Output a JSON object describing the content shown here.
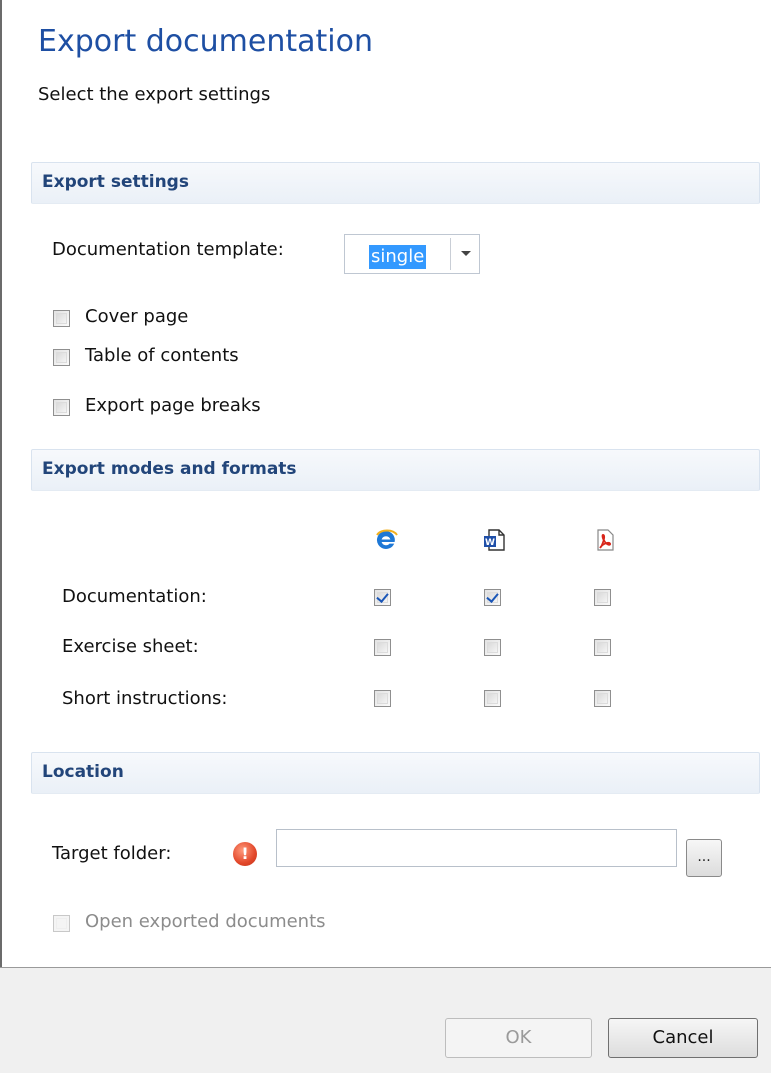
{
  "dialog": {
    "title": "Export documentation",
    "subtitle": "Select the export settings"
  },
  "export_settings": {
    "header": "Export settings",
    "template_label": "Documentation template:",
    "template_value": "single",
    "options": [
      {
        "label": "Cover page",
        "checked": false
      },
      {
        "label": "Table of contents",
        "checked": false
      },
      {
        "label": "Export page breaks",
        "checked": false
      }
    ]
  },
  "modes": {
    "header": "Export modes and formats",
    "format_icons": [
      "internet-explorer-icon",
      "word-document-icon",
      "pdf-icon"
    ],
    "rows": [
      {
        "label": "Documentation:",
        "checks": [
          true,
          true,
          false
        ]
      },
      {
        "label": "Exercise sheet:",
        "checks": [
          false,
          false,
          false
        ]
      },
      {
        "label": "Short instructions:",
        "checks": [
          false,
          false,
          false
        ]
      }
    ]
  },
  "location": {
    "header": "Location",
    "target_label": "Target folder:",
    "target_value": "",
    "browse_label": "...",
    "open_exported_label": "Open exported documents",
    "open_exported_checked": false
  },
  "buttons": {
    "ok": "OK",
    "cancel": "Cancel"
  },
  "colors": {
    "title": "#1e4fa3",
    "section_header_text": "#22457a",
    "selection": "#3399ff",
    "alert": "#e2472a"
  }
}
